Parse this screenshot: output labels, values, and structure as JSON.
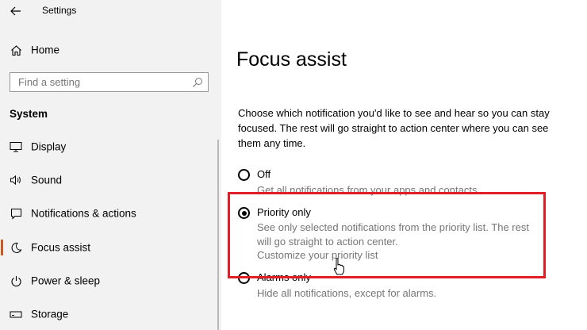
{
  "window": {
    "title": "Settings"
  },
  "sidebar": {
    "home_label": "Home",
    "search_placeholder": "Find a setting",
    "section_header": "System",
    "items": [
      {
        "label": "Display",
        "icon": "display-icon"
      },
      {
        "label": "Sound",
        "icon": "speaker-icon"
      },
      {
        "label": "Notifications & actions",
        "icon": "notification-icon"
      },
      {
        "label": "Focus assist",
        "icon": "moon-icon",
        "selected": true
      },
      {
        "label": "Power & sleep",
        "icon": "power-icon"
      },
      {
        "label": "Storage",
        "icon": "storage-icon"
      }
    ],
    "accent_color": "#cc5a1e"
  },
  "main": {
    "title": "Focus assist",
    "description": "Choose which notification you'd like to see and hear so you can stay focused. The rest will go straight to action center where you can see them any time.",
    "options": [
      {
        "label": "Off",
        "description": "Get all notifications from your apps and contacts.",
        "selected": false
      },
      {
        "label": "Priority only",
        "description": "See only selected notifications from the priority list. The rest will go straight to action center.",
        "link": "Customize your priority list",
        "selected": true
      },
      {
        "label": "Alarms only",
        "description": "Hide all notifications, except for alarms.",
        "selected": false
      }
    ],
    "highlight_color": "#e01e26"
  }
}
